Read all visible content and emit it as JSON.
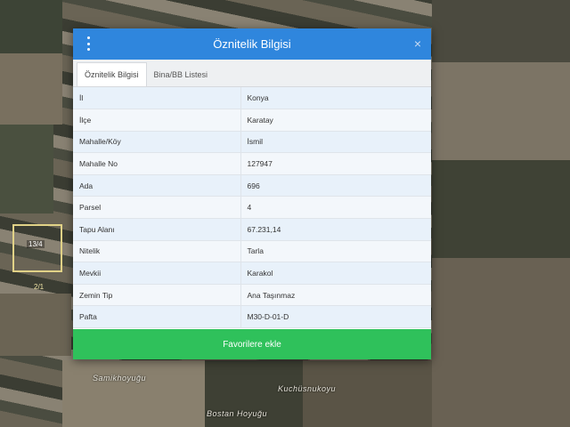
{
  "dialog": {
    "title": "Öznitelik Bilgisi",
    "close_symbol": "×",
    "menu_icon": "vertical-dots-icon",
    "tabs": [
      {
        "label": "Öznitelik Bilgisi",
        "active": true
      },
      {
        "label": "Bina/BB Listesi",
        "active": false
      }
    ],
    "rows": [
      {
        "key": "İl",
        "value": "Konya"
      },
      {
        "key": "İlçe",
        "value": "Karatay"
      },
      {
        "key": "Mahalle/Köy",
        "value": "İsmil"
      },
      {
        "key": "Mahalle No",
        "value": "127947"
      },
      {
        "key": "Ada",
        "value": "696"
      },
      {
        "key": "Parsel",
        "value": "4"
      },
      {
        "key": "Tapu Alanı",
        "value": "67.231,14"
      },
      {
        "key": "Nitelik",
        "value": "Tarla"
      },
      {
        "key": "Mevkii",
        "value": "Karakol"
      },
      {
        "key": "Zemin Tip",
        "value": "Ana Taşınmaz"
      },
      {
        "key": "Pafta",
        "value": "M30-D-01-D"
      }
    ],
    "action_label": "Favorilere ekle"
  },
  "map": {
    "labels": [
      "Samikhoyuğu",
      "Kuchüsnukoyu",
      "Bostan Hoyuğu"
    ],
    "parcel_tag": "13/4",
    "parcel_tag2": "2/1"
  },
  "colors": {
    "header": "#2f86dd",
    "action": "#2fc15b",
    "row_key_bg": "#e8f1fa"
  }
}
